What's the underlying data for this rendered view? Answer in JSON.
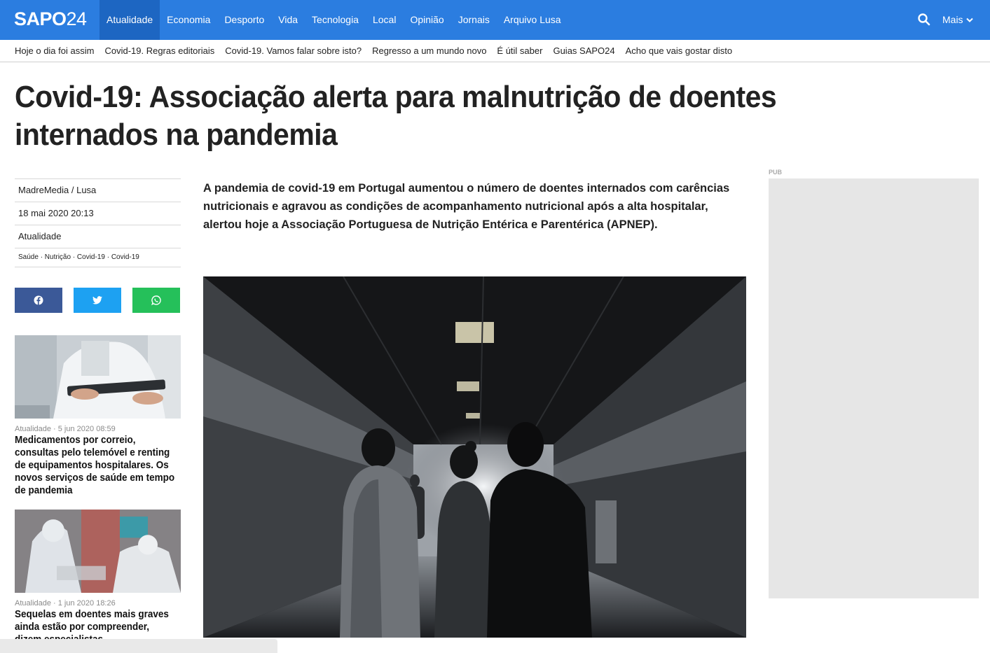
{
  "header": {
    "logo_bold": "SAPO",
    "logo_light": "24",
    "nav": [
      {
        "label": "Atualidade"
      },
      {
        "label": "Economia"
      },
      {
        "label": "Desporto"
      },
      {
        "label": "Vida"
      },
      {
        "label": "Tecnologia"
      },
      {
        "label": "Local"
      },
      {
        "label": "Opinião"
      },
      {
        "label": "Jornais"
      },
      {
        "label": "Arquivo Lusa"
      }
    ],
    "active_nav": "Atualidade",
    "more_label": "Mais",
    "brand_color": "#2b7de0"
  },
  "subnav": [
    {
      "label": "Hoje o dia foi assim"
    },
    {
      "label": "Covid-19. Regras editoriais"
    },
    {
      "label": "Covid-19. Vamos falar sobre isto?"
    },
    {
      "label": "Regresso a um mundo novo"
    },
    {
      "label": "É útil saber"
    },
    {
      "label": "Guias SAPO24"
    },
    {
      "label": "Acho que vais gostar disto"
    }
  ],
  "article": {
    "headline": "Covid-19: Associação alerta para malnutrição de doentes internados na pandemia",
    "author": "MadreMedia / Lusa",
    "date": "18 mai 2020 20:13",
    "section": "Atualidade",
    "tags": "Saúde · Nutrição · Covid-19 · Covid-19",
    "lead": "A pandemia de covid-19 em Portugal aumentou o número de doentes internados com carências nutricionais e agravou as condições de acompanhamento nutricional após a alta hospitalar, alertou hoje a Associação Portuguesa de Nutrição Entérica e Parentérica (APNEP)."
  },
  "share": {
    "facebook_icon": "facebook-icon",
    "twitter_icon": "twitter-icon",
    "whatsapp_icon": "whatsapp-icon"
  },
  "related": [
    {
      "kicker": "Atualidade · 5 jun 2020 08:59",
      "title": "Medicamentos por correio, consultas pelo telemóvel e renting de equipamentos hospitalares. Os novos serviços de saúde em tempo de pandemia"
    },
    {
      "kicker": "Atualidade · 1 jun 2020 18:26",
      "title": "Sequelas em doentes mais graves ainda estão por compreender, dizem especialistas"
    }
  ],
  "ad": {
    "label": "PUB"
  }
}
